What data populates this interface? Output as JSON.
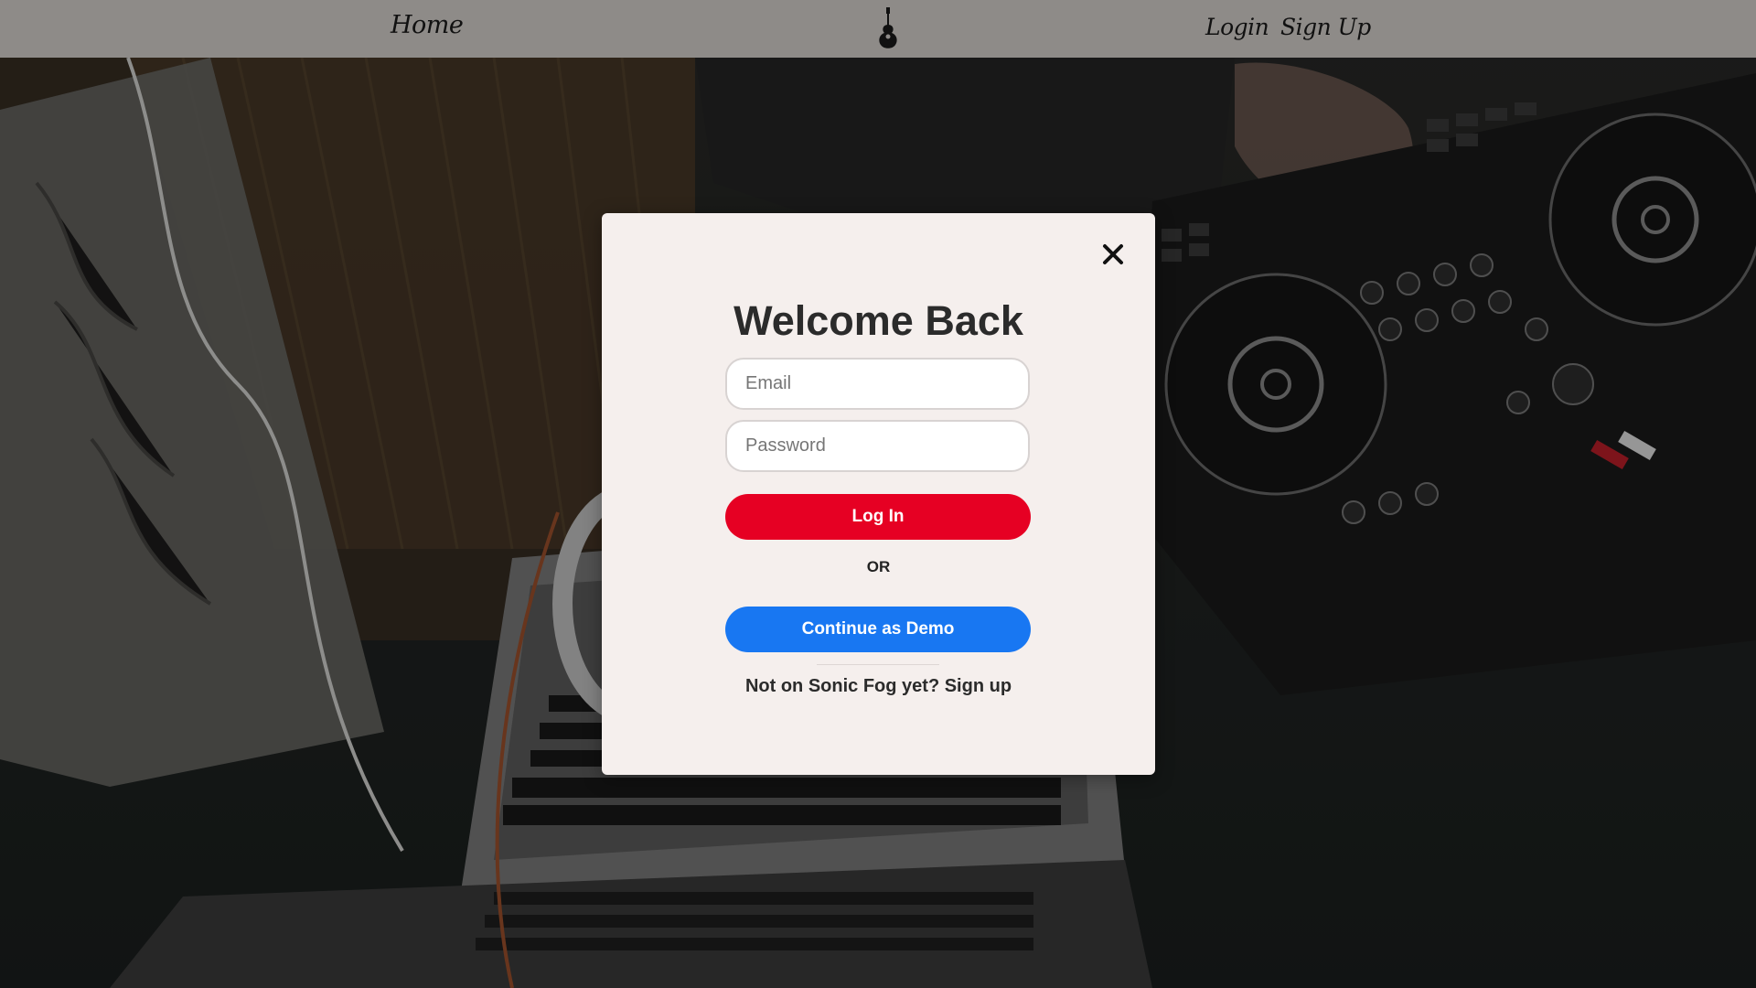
{
  "navbar": {
    "home_label": "Home",
    "login_label": "Login",
    "signup_label": "Sign Up",
    "logo_icon": "guitar-icon"
  },
  "login_modal": {
    "title": "Welcome Back",
    "email_placeholder": "Email",
    "email_value": "",
    "password_placeholder": "Password",
    "password_value": "",
    "login_button": "Log In",
    "or_text": "OR",
    "demo_button": "Continue as Demo",
    "signup_prompt": "Not on Sonic Fog yet? Sign up",
    "close_icon": "close-icon"
  },
  "colors": {
    "navbar_bg": "#8e8b88",
    "modal_bg": "#f5efed",
    "login_button": "#e60023",
    "demo_button": "#1877f2"
  }
}
